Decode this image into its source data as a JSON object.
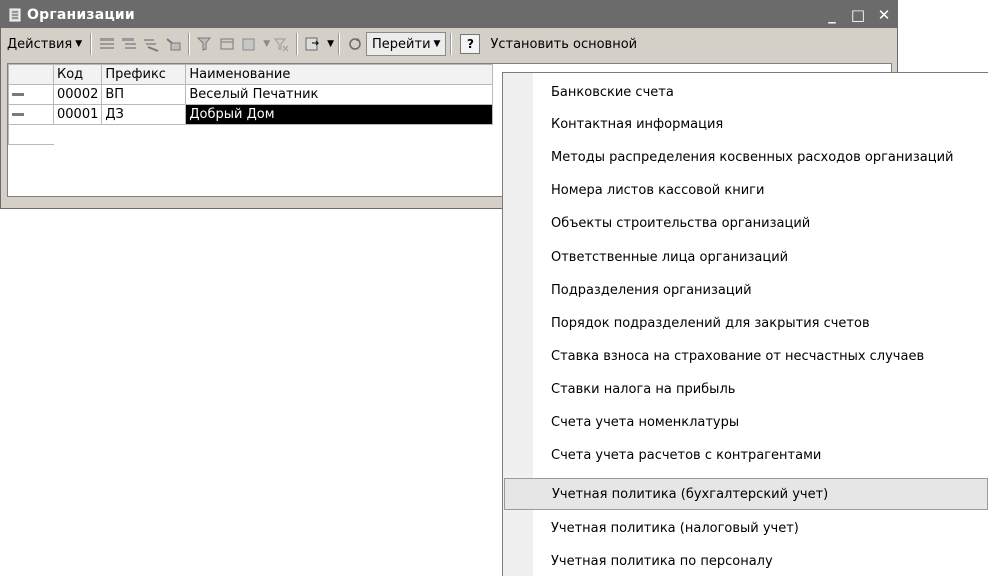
{
  "window": {
    "title": "Организации",
    "icon": "window-app-icon",
    "controls": {
      "minimize": "_",
      "maximize": "□",
      "close": "✕"
    }
  },
  "toolbar": {
    "actions_label": "Действия",
    "goto_label": "Перейти",
    "help_label": "?",
    "set_default_label": "Установить основной",
    "icons": [
      "add-icon",
      "add-group-icon",
      "copy-icon",
      "edit-icon",
      "hierarchy-icon",
      "level-icon",
      "delete-icon",
      "filter-off-icon",
      "export-icon",
      "refresh-icon"
    ]
  },
  "table": {
    "columns": [
      "",
      "Код",
      "Префикс",
      "Наименование"
    ],
    "rows": [
      {
        "code": "00002",
        "prefix": "ВП",
        "name": "Веселый Печатник",
        "selected": false
      },
      {
        "code": "00001",
        "prefix": "ДЗ",
        "name": "Добрый Дом",
        "selected": true
      }
    ]
  },
  "menu": {
    "items": [
      "Банковские счета",
      "Контактная информация",
      "Методы распределения косвенных расходов организаций",
      "Номера листов кассовой книги",
      "Объекты строительства организаций",
      "Ответственные лица организаций",
      "Подразделения организаций",
      "Порядок подразделений для закрытия счетов",
      "Ставка взноса на страхование от несчастных случаев",
      "Ставки налога на прибыль",
      "Счета учета номенклатуры",
      "Счета учета расчетов с контрагентами",
      "Учетная политика (бухгалтерский учет)",
      "Учетная политика (налоговый учет)",
      "Учетная политика по персоналу"
    ],
    "highlighted_index": 12
  }
}
